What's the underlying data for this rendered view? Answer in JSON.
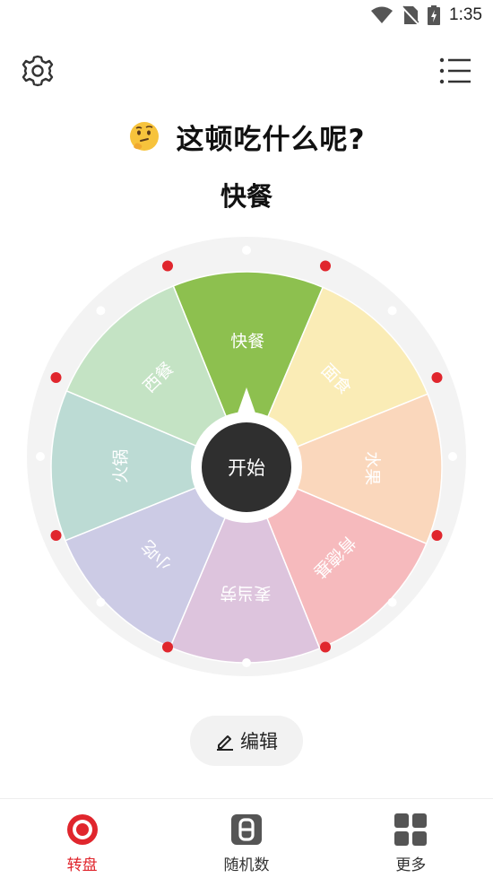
{
  "status_bar": {
    "time": "1:35"
  },
  "header": {
    "emoji": "🤔",
    "title": "这顿吃什么呢?"
  },
  "result": "快餐",
  "wheel": {
    "center_label": "开始",
    "segments": [
      {
        "label": "快餐",
        "color": "#8dc04f"
      },
      {
        "label": "面食",
        "color": "#faecb6"
      },
      {
        "label": "水果",
        "color": "#fad7bc"
      },
      {
        "label": "肯德基",
        "color": "#f6babd"
      },
      {
        "label": "麦当劳",
        "color": "#ddc4dd"
      },
      {
        "label": "小吃",
        "color": "#cccbe5"
      },
      {
        "label": "火锅",
        "color": "#bcdbd4"
      },
      {
        "label": "西餐",
        "color": "#c4e3c4"
      }
    ]
  },
  "edit_button": {
    "label": "编辑"
  },
  "bottom_nav": {
    "items": [
      {
        "label": "转盘",
        "icon": "wheel-icon",
        "active": true
      },
      {
        "label": "随机数",
        "icon": "dice-icon",
        "active": false
      },
      {
        "label": "更多",
        "icon": "grid-icon",
        "active": false
      }
    ]
  },
  "colors": {
    "accent": "#e0262d",
    "ring": "#f3f3f3",
    "center": "#2f2f2f"
  }
}
